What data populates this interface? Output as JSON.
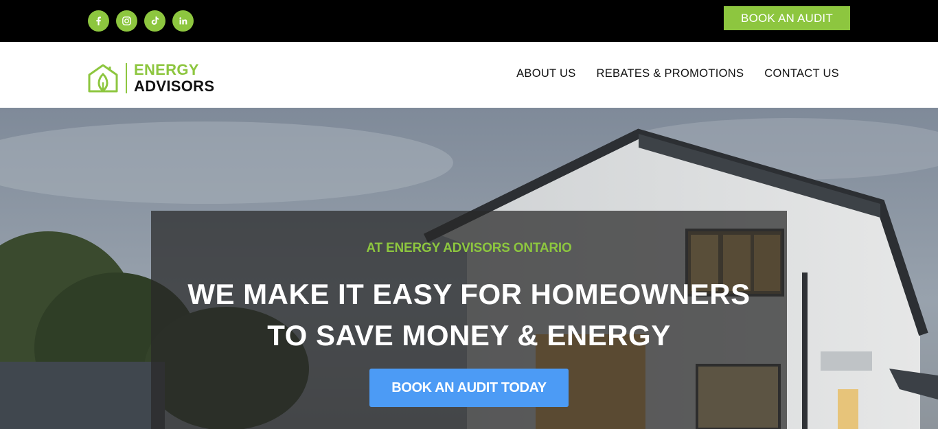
{
  "topbar": {
    "social_icons": [
      "facebook-icon",
      "instagram-icon",
      "tiktok-icon",
      "linkedin-icon"
    ],
    "cta_label": "BOOK AN AUDIT"
  },
  "header": {
    "logo": {
      "line1": "ENERGY",
      "line2": "ADVISORS"
    },
    "nav": [
      {
        "label": "ABOUT US"
      },
      {
        "label": "REBATES & PROMOTIONS"
      },
      {
        "label": "CONTACT US"
      }
    ]
  },
  "hero": {
    "eyebrow": "AT ENERGY ADVISORS ONTARIO",
    "headline_line1": "WE MAKE IT EASY FOR HOMEOWNERS",
    "headline_line2": "TO SAVE MONEY & ENERGY",
    "cta_label": "BOOK AN AUDIT TODAY"
  },
  "colors": {
    "brand_green": "#8dc63f",
    "cta_blue": "#4c9bf5",
    "topbar_bg": "#000000"
  }
}
